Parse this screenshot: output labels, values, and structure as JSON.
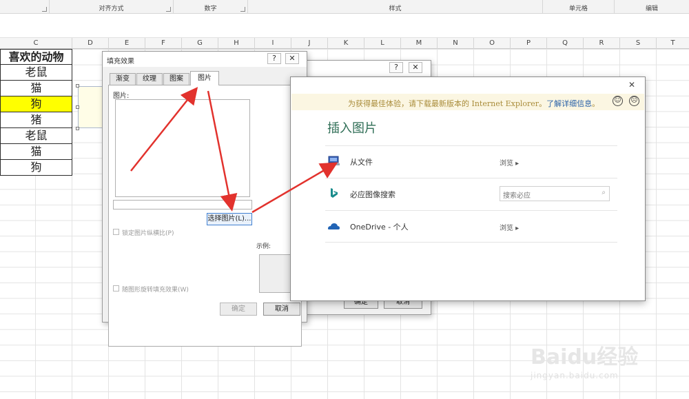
{
  "ribbon": {
    "groups": [
      "对齐方式",
      "数字",
      "样式",
      "单元格",
      "编辑"
    ]
  },
  "columns": [
    "C",
    "D",
    "E",
    "F",
    "G",
    "H",
    "I",
    "J",
    "K",
    "L",
    "M",
    "N",
    "O",
    "P",
    "Q",
    "R",
    "S",
    "T"
  ],
  "table": {
    "header": "喜欢的动物",
    "rows": [
      "老鼠",
      "猫",
      "狗",
      "猪",
      "老鼠",
      "猫",
      "狗"
    ],
    "highlight_color": "#ffff00"
  },
  "fill_dialog": {
    "title": "填充效果",
    "help": "?",
    "close": "✕",
    "tabs": [
      "渐变",
      "纹理",
      "图案",
      "图片"
    ],
    "picture_label": "图片:",
    "select_button": "选择图片(L)...",
    "lock_ratio": "锁定图片纵横比(P)",
    "rotate_with_shape": "随图形旋转填充效果(W)",
    "sample_label": "示例:",
    "ok": "确定",
    "cancel": "取消"
  },
  "back_dialog": {
    "help": "?",
    "close": "✕",
    "ok": "确定",
    "cancel": "取消"
  },
  "insert_picture": {
    "close": "✕",
    "ie_message": "为获得最佳体验，请下载最新版本的 Internet Explorer。",
    "ie_link": "了解详细信息",
    "ie_dot": "。",
    "title": "插入图片",
    "from_file": "从文件",
    "browse": "浏览 ▸",
    "bing_search": "必应图像搜索",
    "search_placeholder": "搜索必应",
    "onedrive": "OneDrive - 个人",
    "browse2": "浏览 ▸"
  },
  "watermark": {
    "brand": "Baidu经验",
    "url": "jingyan.baidu.com"
  },
  "colors": {
    "arrow": "#e2322d",
    "insert_title": "#2f6e56",
    "ie_bar": "#fbf6e2"
  }
}
